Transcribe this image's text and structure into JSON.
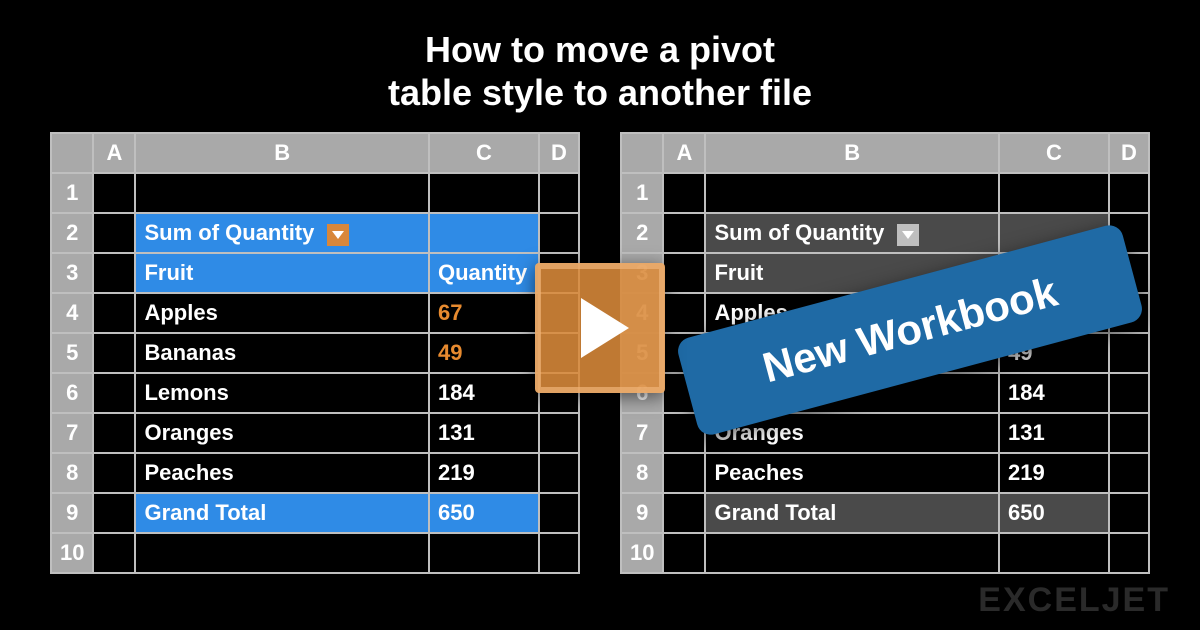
{
  "title_line1": "How to move a pivot",
  "title_line2": "table style to another file",
  "columns": {
    "a": "A",
    "b": "B",
    "c": "C",
    "d": "D"
  },
  "rows": [
    "1",
    "2",
    "3",
    "4",
    "5",
    "6",
    "7",
    "8",
    "9",
    "10"
  ],
  "pivot": {
    "sum_label": "Sum of Quantity",
    "row_label": "Fruit",
    "val_label": "Quantity",
    "items": [
      {
        "name": "Apples",
        "qty": 67
      },
      {
        "name": "Bananas",
        "qty": 49
      },
      {
        "name": "Lemons",
        "qty": 184
      },
      {
        "name": "Oranges",
        "qty": 131
      },
      {
        "name": "Peaches",
        "qty": 219
      }
    ],
    "total_label": "Grand Total",
    "total_value": 650
  },
  "banner_text": "New Workbook",
  "brand": "EXCELJET"
}
